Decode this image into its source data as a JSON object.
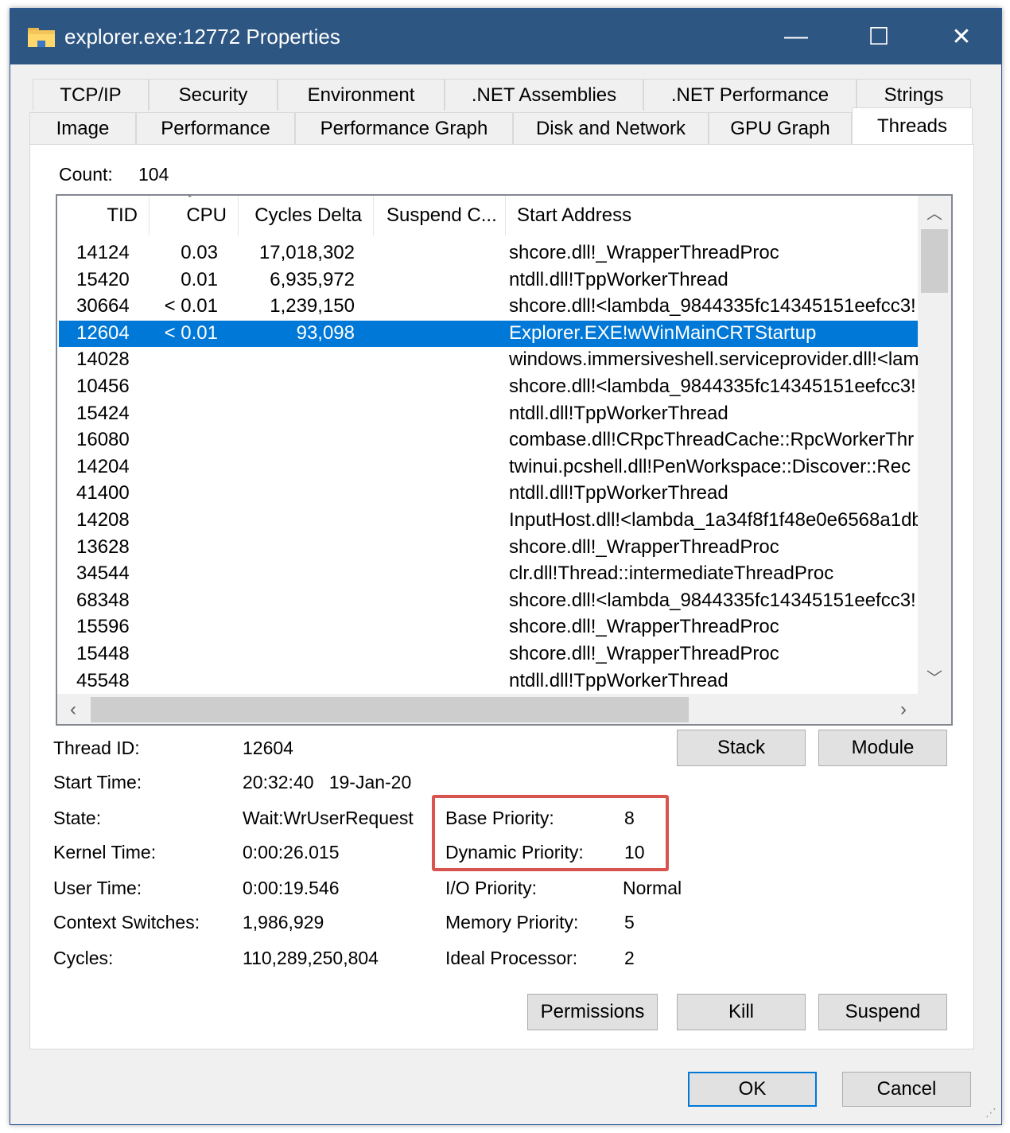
{
  "window": {
    "title": "explorer.exe:12772 Properties",
    "icon": "folder-icon",
    "controls": {
      "minimize": "—",
      "maximize": "☐",
      "close": "✕"
    }
  },
  "tabs": {
    "row1": [
      "TCP/IP",
      "Security",
      "Environment",
      ".NET Assemblies",
      ".NET Performance",
      "Strings"
    ],
    "row2": [
      "Image",
      "Performance",
      "Performance Graph",
      "Disk and Network",
      "GPU Graph",
      "Threads"
    ],
    "active": "Threads"
  },
  "count": {
    "label": "Count:",
    "value": "104"
  },
  "list": {
    "columns": [
      "TID",
      "CPU",
      "Cycles Delta",
      "Suspend C...",
      "Start Address"
    ],
    "sort_indicator": "ˇ",
    "rows": [
      {
        "tid": "14124",
        "cpu": "0.03",
        "cycles": "17,018,302",
        "start": "shcore.dll!_WrapperThreadProc"
      },
      {
        "tid": "15420",
        "cpu": "0.01",
        "cycles": "6,935,972",
        "start": "ntdll.dll!TppWorkerThread"
      },
      {
        "tid": "30664",
        "cpu": "< 0.01",
        "cycles": "1,239,150",
        "start": "shcore.dll!<lambda_9844335fc14345151eefcc3!"
      },
      {
        "tid": "12604",
        "cpu": "< 0.01",
        "cycles": "93,098",
        "start": "Explorer.EXE!wWinMainCRTStartup",
        "selected": true
      },
      {
        "tid": "14028",
        "cpu": "",
        "cycles": "",
        "start": "windows.immersiveshell.serviceprovider.dll!<lamb"
      },
      {
        "tid": "10456",
        "cpu": "",
        "cycles": "",
        "start": "shcore.dll!<lambda_9844335fc14345151eefcc3!"
      },
      {
        "tid": "15424",
        "cpu": "",
        "cycles": "",
        "start": "ntdll.dll!TppWorkerThread"
      },
      {
        "tid": "16080",
        "cpu": "",
        "cycles": "",
        "start": "combase.dll!CRpcThreadCache::RpcWorkerThr"
      },
      {
        "tid": "14204",
        "cpu": "",
        "cycles": "",
        "start": "twinui.pcshell.dll!PenWorkspace::Discover::Rec"
      },
      {
        "tid": "41400",
        "cpu": "",
        "cycles": "",
        "start": "ntdll.dll!TppWorkerThread"
      },
      {
        "tid": "14208",
        "cpu": "",
        "cycles": "",
        "start": "InputHost.dll!<lambda_1a34f8f1f48e0e6568a1db"
      },
      {
        "tid": "13628",
        "cpu": "",
        "cycles": "",
        "start": "shcore.dll!_WrapperThreadProc"
      },
      {
        "tid": "34544",
        "cpu": "",
        "cycles": "",
        "start": "clr.dll!Thread::intermediateThreadProc"
      },
      {
        "tid": "68348",
        "cpu": "",
        "cycles": "",
        "start": "shcore.dll!<lambda_9844335fc14345151eefcc3!"
      },
      {
        "tid": "15596",
        "cpu": "",
        "cycles": "",
        "start": "shcore.dll!_WrapperThreadProc"
      },
      {
        "tid": "15448",
        "cpu": "",
        "cycles": "",
        "start": "shcore.dll!_WrapperThreadProc"
      },
      {
        "tid": "45548",
        "cpu": "",
        "cycles": "",
        "start": "ntdll.dll!TppWorkerThread"
      }
    ]
  },
  "details": {
    "thread_id": {
      "label": "Thread ID:",
      "value": "12604"
    },
    "start_time": {
      "label": "Start Time:",
      "value": "20:32:40   19-Jan-20"
    },
    "state": {
      "label": "State:",
      "value": "Wait:WrUserRequest"
    },
    "kernel_time": {
      "label": "Kernel Time:",
      "value": "0:00:26.015"
    },
    "user_time": {
      "label": "User Time:",
      "value": "0:00:19.546"
    },
    "context_switches": {
      "label": "Context Switches:",
      "value": "1,986,929"
    },
    "cycles": {
      "label": "Cycles:",
      "value": "110,289,250,804"
    },
    "base_priority": {
      "label": "Base Priority:",
      "value": "8"
    },
    "dynamic_priority": {
      "label": "Dynamic Priority:",
      "value": "10"
    },
    "io_priority": {
      "label": "I/O Priority:",
      "value": "Normal"
    },
    "memory_priority": {
      "label": "Memory Priority:",
      "value": "5"
    },
    "ideal_processor": {
      "label": "Ideal Processor:",
      "value": "2"
    }
  },
  "buttons": {
    "stack": "Stack",
    "module": "Module",
    "permissions": "Permissions",
    "kill": "Kill",
    "suspend": "Suspend",
    "ok": "OK",
    "cancel": "Cancel"
  },
  "colors": {
    "titlebar": "#2d5682",
    "selection": "#0078d7",
    "highlight_box": "#d9534f"
  }
}
